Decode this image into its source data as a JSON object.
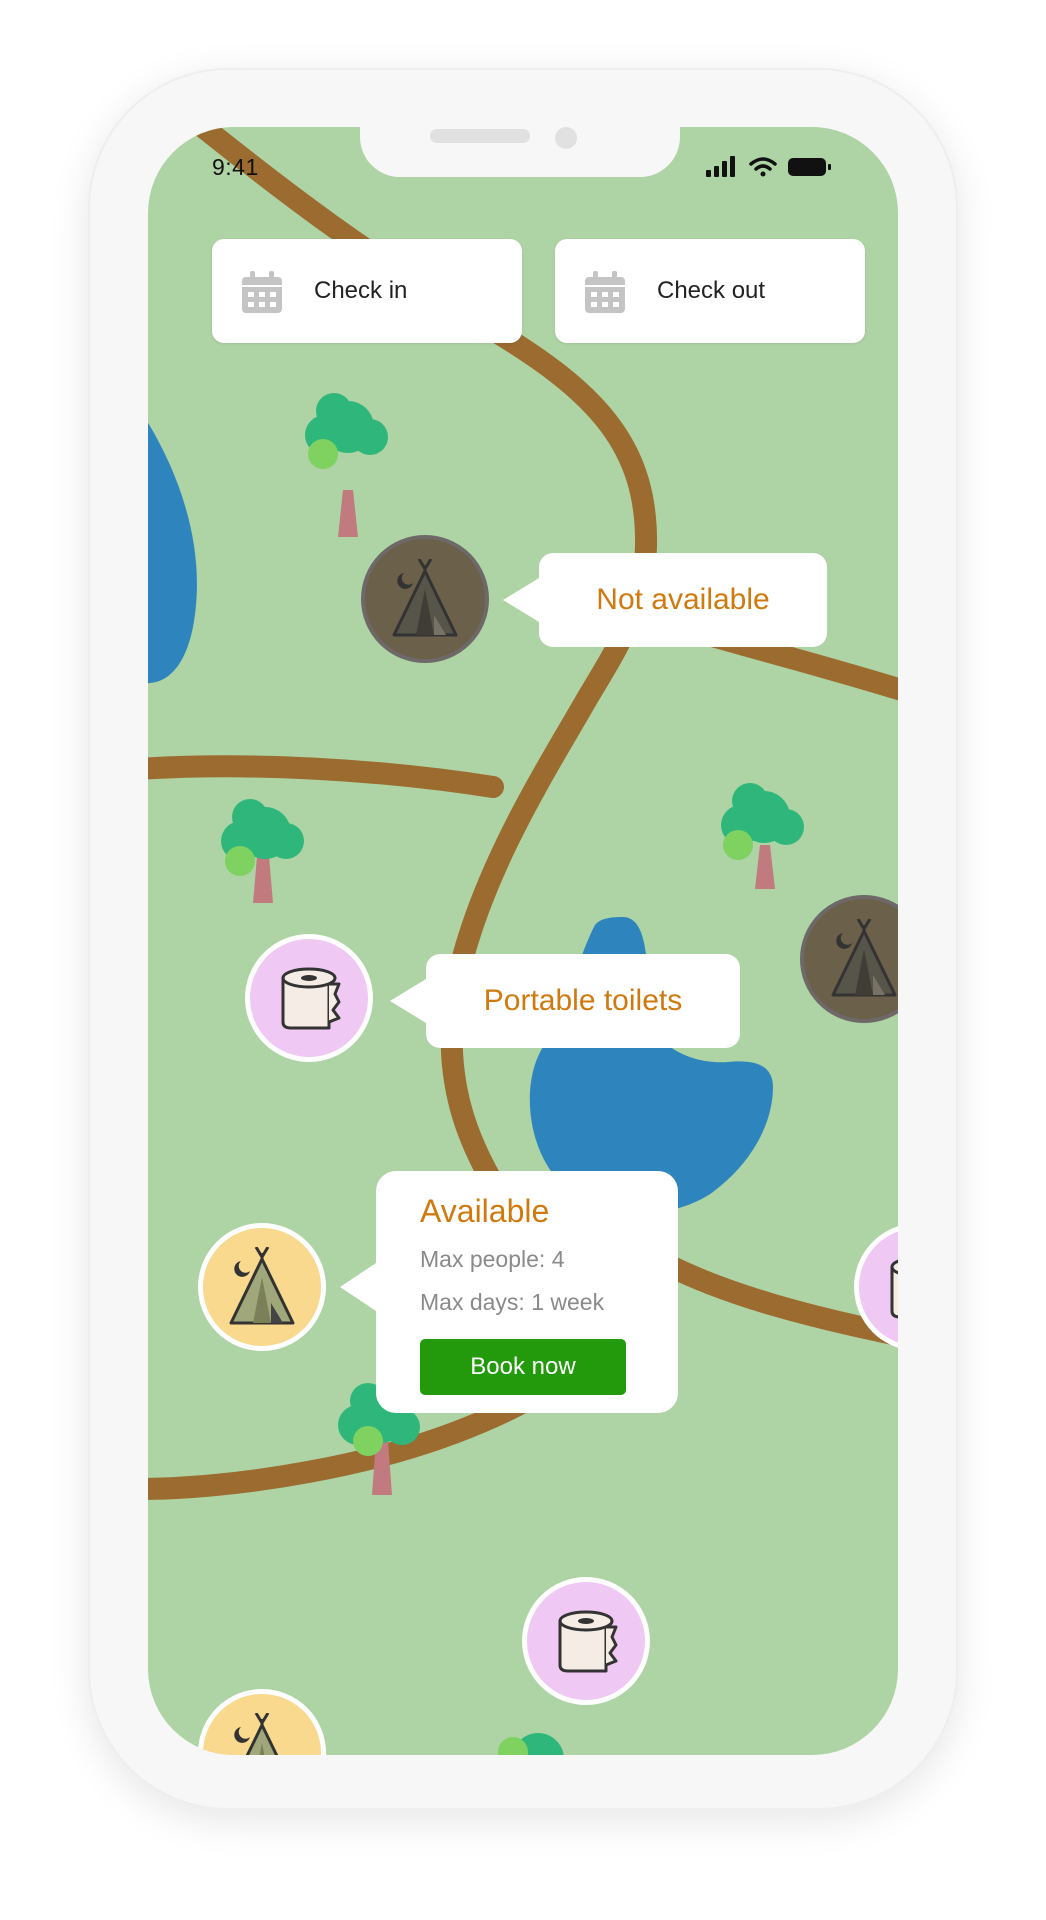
{
  "status_bar": {
    "time": "9:41"
  },
  "date_controls": {
    "check_in_label": "Check in",
    "check_out_label": "Check out"
  },
  "tooltips": {
    "not_available": "Not available",
    "portable_toilets": "Portable toilets"
  },
  "campsite_card": {
    "status": "Available",
    "max_people": "Max people: 4",
    "max_days": "Max days: 1 week",
    "book_button": "Book now"
  },
  "colors": {
    "map_background": "#aed3a4",
    "path": "#9b6b30",
    "water": "#2e85bd",
    "accent_text": "#d0790e",
    "book_button": "#229a0c",
    "occupied_marker": "#6b6049",
    "available_marker": "#f8d98e",
    "toilet_marker": "#efc9f4"
  },
  "icons": {
    "calendar": "calendar-icon",
    "tent": "tent-icon",
    "toilet_paper": "toilet-paper-icon",
    "tree": "tree-icon"
  }
}
